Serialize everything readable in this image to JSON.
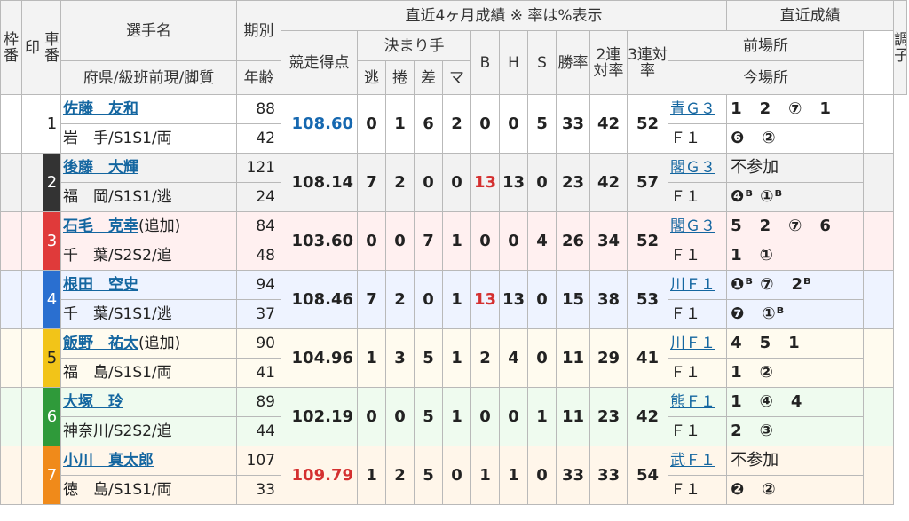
{
  "header": {
    "waku": "枠番",
    "shirushi": "印",
    "sha": "車番",
    "name": "選手名",
    "pref": "府県/級班前現/脚質",
    "kibetsu": "期別",
    "age": "年齢",
    "recent4": "直近4ヶ月成績 ※ 率は%表示",
    "score": "競走得点",
    "kimarite": "決まり手",
    "nige": "逃",
    "makuri": "捲",
    "sashi": "差",
    "ma": "マ",
    "b": "B",
    "h": "H",
    "s": "S",
    "win": "勝率",
    "niren": "2連対率",
    "sanren": "3連対率",
    "recent": "直近成績",
    "prev": "前場所",
    "now": "今場所",
    "cond": "調子"
  },
  "riders": [
    {
      "car": "1",
      "name": "佐藤　友和",
      "extra": "",
      "pref": "岩　手/S1S1/両",
      "ki": "88",
      "age": "42",
      "score": "108.60",
      "nige": "0",
      "makuri": "1",
      "sashi": "6",
      "ma": "2",
      "b": "0",
      "h": "0",
      "s": "5",
      "win": "33",
      "niren": "42",
      "sanren": "52",
      "prev_place": "青Ｇ３",
      "prev_res": "1　2　⑦　1",
      "now_place": "Ｆ１",
      "now_res": "❻　②"
    },
    {
      "car": "2",
      "name": "後藤　大輝",
      "extra": "",
      "pref": "福　岡/S1S1/逃",
      "ki": "121",
      "age": "24",
      "score": "108.14",
      "nige": "7",
      "makuri": "2",
      "sashi": "0",
      "ma": "0",
      "b": "13",
      "h": "13",
      "s": "0",
      "win": "23",
      "niren": "42",
      "sanren": "57",
      "prev_place": "閣Ｇ３",
      "prev_res": "不参加",
      "now_place": "Ｆ１",
      "now_res": "❹ᴮ ①ᴮ"
    },
    {
      "car": "3",
      "name": "石毛　克幸",
      "extra": "(追加)",
      "pref": "千　葉/S2S2/追",
      "ki": "84",
      "age": "48",
      "score": "103.60",
      "nige": "0",
      "makuri": "0",
      "sashi": "7",
      "ma": "1",
      "b": "0",
      "h": "0",
      "s": "4",
      "win": "26",
      "niren": "34",
      "sanren": "52",
      "prev_place": "閣Ｇ３",
      "prev_res": "5　2　⑦　6",
      "now_place": "Ｆ１",
      "now_res": "1　①"
    },
    {
      "car": "4",
      "name": "根田　空史",
      "extra": "",
      "pref": "千　葉/S1S1/逃",
      "ki": "94",
      "age": "37",
      "score": "108.46",
      "nige": "7",
      "makuri": "2",
      "sashi": "0",
      "ma": "1",
      "b": "13",
      "h": "13",
      "s": "0",
      "win": "15",
      "niren": "38",
      "sanren": "53",
      "prev_place": "川Ｆ１",
      "prev_res": "❶ᴮ ⑦　2ᴮ",
      "now_place": "Ｆ１",
      "now_res": "❼　①ᴮ"
    },
    {
      "car": "5",
      "name": "飯野　祐太",
      "extra": "(追加)",
      "pref": "福　島/S1S1/両",
      "ki": "90",
      "age": "41",
      "score": "104.96",
      "nige": "1",
      "makuri": "3",
      "sashi": "5",
      "ma": "1",
      "b": "2",
      "h": "4",
      "s": "0",
      "win": "11",
      "niren": "29",
      "sanren": "41",
      "prev_place": "川Ｆ１",
      "prev_res": "4　5　1",
      "now_place": "Ｆ１",
      "now_res": "1　②"
    },
    {
      "car": "6",
      "name": "大塚　玲",
      "extra": "",
      "pref": "神奈川/S2S2/追",
      "ki": "89",
      "age": "44",
      "score": "102.19",
      "nige": "0",
      "makuri": "0",
      "sashi": "5",
      "ma": "1",
      "b": "0",
      "h": "0",
      "s": "1",
      "win": "11",
      "niren": "23",
      "sanren": "42",
      "prev_place": "熊Ｆ１",
      "prev_res": "1　④　4",
      "now_place": "Ｆ１",
      "now_res": "2　③"
    },
    {
      "car": "7",
      "name": "小川　真太郎",
      "extra": "",
      "pref": "徳　島/S1S1/両",
      "ki": "107",
      "age": "33",
      "score": "109.79",
      "nige": "1",
      "makuri": "2",
      "sashi": "5",
      "ma": "0",
      "b": "1",
      "h": "1",
      "s": "0",
      "win": "33",
      "niren": "33",
      "sanren": "54",
      "prev_place": "武Ｆ１",
      "prev_res": "不参加",
      "now_place": "Ｆ１",
      "now_res": "❷　②"
    }
  ],
  "colors": {
    "link": "#1466a0",
    "score_blue": "#1668b0",
    "score_red": "#d43030",
    "car1": "#ffffff",
    "car2": "#333333",
    "car3": "#e03a3a",
    "car4": "#2a6fd0",
    "car5": "#f2c418",
    "car6": "#2f9a3a",
    "car7": "#f08a1a"
  }
}
